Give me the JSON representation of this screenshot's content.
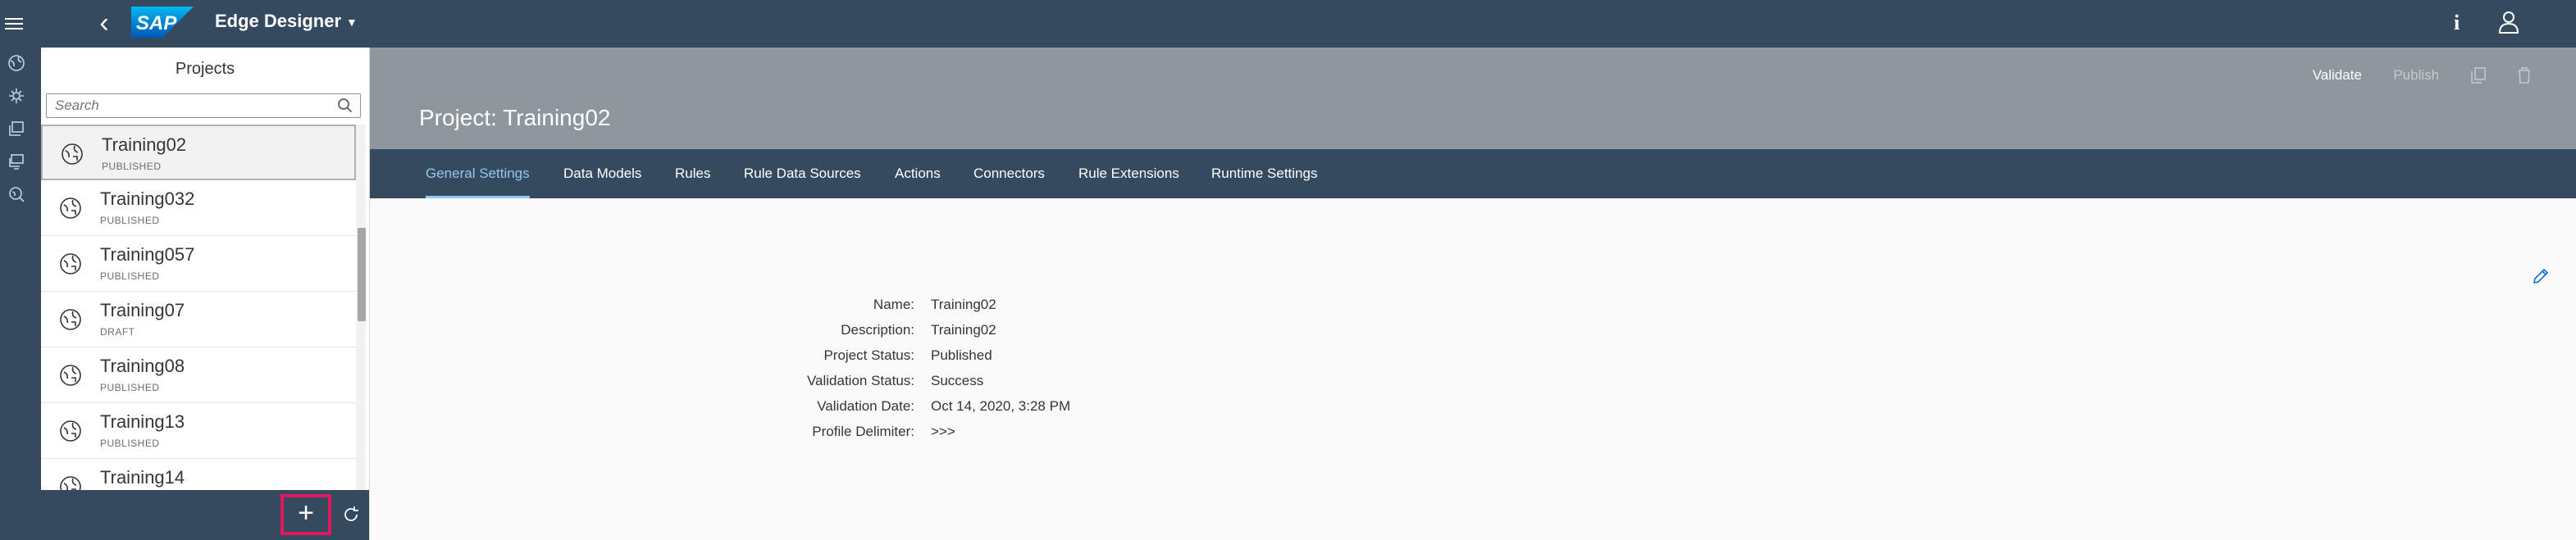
{
  "shell": {
    "app_title": "Edge Designer",
    "logo_text": "SAP",
    "info_label": "i",
    "icons": [
      "menu-icon",
      "back-icon",
      "info-icon",
      "user-icon"
    ]
  },
  "rail": {
    "icons": [
      "globe-icon",
      "gear-network-icon",
      "stack-icon",
      "monitor-icon",
      "search-globe-icon"
    ]
  },
  "master": {
    "title": "Projects",
    "search_placeholder": "Search",
    "items": [
      {
        "name": "Training02",
        "status": "PUBLISHED"
      },
      {
        "name": "Training032",
        "status": "PUBLISHED"
      },
      {
        "name": "Training057",
        "status": "PUBLISHED"
      },
      {
        "name": "Training07",
        "status": "DRAFT"
      },
      {
        "name": "Training08",
        "status": "PUBLISHED"
      },
      {
        "name": "Training13",
        "status": "PUBLISHED"
      },
      {
        "name": "Training14",
        "status": ""
      }
    ],
    "add_label": "+"
  },
  "detail": {
    "title": "Project: Training02",
    "actions": {
      "validate": "Validate",
      "publish": "Publish"
    },
    "tabs": [
      "General Settings",
      "Data Models",
      "Rules",
      "Rule Data Sources",
      "Actions",
      "Connectors",
      "Rule Extensions",
      "Runtime Settings"
    ],
    "fields": [
      {
        "label": "Name:",
        "value": "Training02"
      },
      {
        "label": "Description:",
        "value": "Training02"
      },
      {
        "label": "Project Status:",
        "value": "Published"
      },
      {
        "label": "Validation Status:",
        "value": "Success"
      },
      {
        "label": "Validation Date:",
        "value": "Oct 14, 2020, 3:28 PM"
      },
      {
        "label": "Profile Delimiter:",
        "value": ">>>"
      }
    ]
  },
  "colors": {
    "shell": "#354a5f",
    "object_header": "#8e979d",
    "active_tab": "#91c8f6",
    "highlight": "#e0185f"
  }
}
